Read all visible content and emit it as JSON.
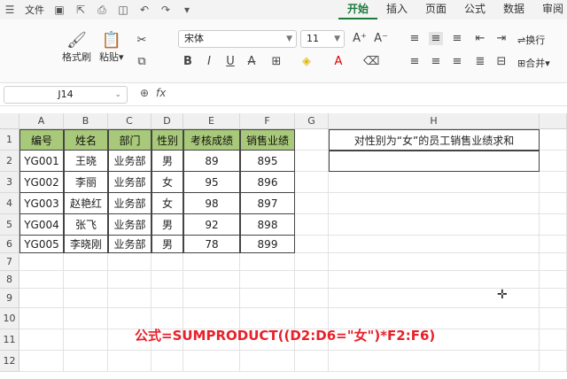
{
  "menubar": {
    "file": "文件",
    "tabs": [
      "开始",
      "插入",
      "页面",
      "公式",
      "数据",
      "审阅"
    ],
    "active_tab": "开始"
  },
  "ribbon": {
    "format_painter": "格式刷",
    "paste": "粘贴",
    "font_name": "宋体",
    "font_size": "11",
    "wrap": "换行",
    "merge": "合并"
  },
  "formula_bar": {
    "name_box": "J14",
    "fx": "fx"
  },
  "columns": [
    "A",
    "B",
    "C",
    "D",
    "E",
    "F",
    "G",
    "H"
  ],
  "rows": [
    "1",
    "2",
    "3",
    "4",
    "5",
    "6",
    "7",
    "8",
    "9",
    "10",
    "11",
    "12"
  ],
  "table": {
    "headers": [
      "编号",
      "姓名",
      "部门",
      "性别",
      "考核成绩",
      "销售业绩"
    ],
    "data": [
      [
        "YG001",
        "王晓",
        "业务部",
        "男",
        "89",
        "895"
      ],
      [
        "YG002",
        "李丽",
        "业务部",
        "女",
        "95",
        "896"
      ],
      [
        "YG003",
        "赵艳红",
        "业务部",
        "女",
        "98",
        "897"
      ],
      [
        "YG004",
        "张飞",
        "业务部",
        "男",
        "92",
        "898"
      ],
      [
        "YG005",
        "李晓刚",
        "业务部",
        "男",
        "78",
        "899"
      ]
    ]
  },
  "h1_text": "对性别为“女”的员工销售业绩求和",
  "formula_text": "公式=SUMPRODUCT((D2:D6=\"女\")*F2:F6)",
  "colors": {
    "header_fill": "#a9c97a",
    "accent": "#1b7a3a",
    "formula": "#e8202a"
  }
}
